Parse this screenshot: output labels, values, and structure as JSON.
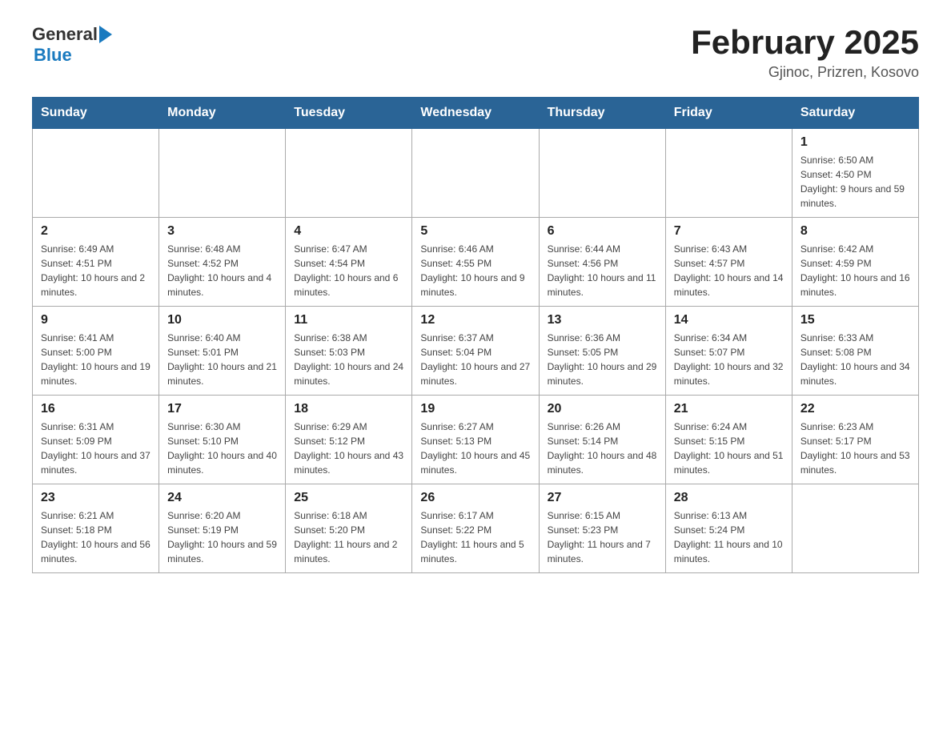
{
  "header": {
    "logo_general": "General",
    "logo_blue": "Blue",
    "title": "February 2025",
    "subtitle": "Gjinoc, Prizren, Kosovo"
  },
  "columns": [
    "Sunday",
    "Monday",
    "Tuesday",
    "Wednesday",
    "Thursday",
    "Friday",
    "Saturday"
  ],
  "weeks": [
    [
      {
        "day": "",
        "info": ""
      },
      {
        "day": "",
        "info": ""
      },
      {
        "day": "",
        "info": ""
      },
      {
        "day": "",
        "info": ""
      },
      {
        "day": "",
        "info": ""
      },
      {
        "day": "",
        "info": ""
      },
      {
        "day": "1",
        "info": "Sunrise: 6:50 AM\nSunset: 4:50 PM\nDaylight: 9 hours and 59 minutes."
      }
    ],
    [
      {
        "day": "2",
        "info": "Sunrise: 6:49 AM\nSunset: 4:51 PM\nDaylight: 10 hours and 2 minutes."
      },
      {
        "day": "3",
        "info": "Sunrise: 6:48 AM\nSunset: 4:52 PM\nDaylight: 10 hours and 4 minutes."
      },
      {
        "day": "4",
        "info": "Sunrise: 6:47 AM\nSunset: 4:54 PM\nDaylight: 10 hours and 6 minutes."
      },
      {
        "day": "5",
        "info": "Sunrise: 6:46 AM\nSunset: 4:55 PM\nDaylight: 10 hours and 9 minutes."
      },
      {
        "day": "6",
        "info": "Sunrise: 6:44 AM\nSunset: 4:56 PM\nDaylight: 10 hours and 11 minutes."
      },
      {
        "day": "7",
        "info": "Sunrise: 6:43 AM\nSunset: 4:57 PM\nDaylight: 10 hours and 14 minutes."
      },
      {
        "day": "8",
        "info": "Sunrise: 6:42 AM\nSunset: 4:59 PM\nDaylight: 10 hours and 16 minutes."
      }
    ],
    [
      {
        "day": "9",
        "info": "Sunrise: 6:41 AM\nSunset: 5:00 PM\nDaylight: 10 hours and 19 minutes."
      },
      {
        "day": "10",
        "info": "Sunrise: 6:40 AM\nSunset: 5:01 PM\nDaylight: 10 hours and 21 minutes."
      },
      {
        "day": "11",
        "info": "Sunrise: 6:38 AM\nSunset: 5:03 PM\nDaylight: 10 hours and 24 minutes."
      },
      {
        "day": "12",
        "info": "Sunrise: 6:37 AM\nSunset: 5:04 PM\nDaylight: 10 hours and 27 minutes."
      },
      {
        "day": "13",
        "info": "Sunrise: 6:36 AM\nSunset: 5:05 PM\nDaylight: 10 hours and 29 minutes."
      },
      {
        "day": "14",
        "info": "Sunrise: 6:34 AM\nSunset: 5:07 PM\nDaylight: 10 hours and 32 minutes."
      },
      {
        "day": "15",
        "info": "Sunrise: 6:33 AM\nSunset: 5:08 PM\nDaylight: 10 hours and 34 minutes."
      }
    ],
    [
      {
        "day": "16",
        "info": "Sunrise: 6:31 AM\nSunset: 5:09 PM\nDaylight: 10 hours and 37 minutes."
      },
      {
        "day": "17",
        "info": "Sunrise: 6:30 AM\nSunset: 5:10 PM\nDaylight: 10 hours and 40 minutes."
      },
      {
        "day": "18",
        "info": "Sunrise: 6:29 AM\nSunset: 5:12 PM\nDaylight: 10 hours and 43 minutes."
      },
      {
        "day": "19",
        "info": "Sunrise: 6:27 AM\nSunset: 5:13 PM\nDaylight: 10 hours and 45 minutes."
      },
      {
        "day": "20",
        "info": "Sunrise: 6:26 AM\nSunset: 5:14 PM\nDaylight: 10 hours and 48 minutes."
      },
      {
        "day": "21",
        "info": "Sunrise: 6:24 AM\nSunset: 5:15 PM\nDaylight: 10 hours and 51 minutes."
      },
      {
        "day": "22",
        "info": "Sunrise: 6:23 AM\nSunset: 5:17 PM\nDaylight: 10 hours and 53 minutes."
      }
    ],
    [
      {
        "day": "23",
        "info": "Sunrise: 6:21 AM\nSunset: 5:18 PM\nDaylight: 10 hours and 56 minutes."
      },
      {
        "day": "24",
        "info": "Sunrise: 6:20 AM\nSunset: 5:19 PM\nDaylight: 10 hours and 59 minutes."
      },
      {
        "day": "25",
        "info": "Sunrise: 6:18 AM\nSunset: 5:20 PM\nDaylight: 11 hours and 2 minutes."
      },
      {
        "day": "26",
        "info": "Sunrise: 6:17 AM\nSunset: 5:22 PM\nDaylight: 11 hours and 5 minutes."
      },
      {
        "day": "27",
        "info": "Sunrise: 6:15 AM\nSunset: 5:23 PM\nDaylight: 11 hours and 7 minutes."
      },
      {
        "day": "28",
        "info": "Sunrise: 6:13 AM\nSunset: 5:24 PM\nDaylight: 11 hours and 10 minutes."
      },
      {
        "day": "",
        "info": ""
      }
    ]
  ]
}
